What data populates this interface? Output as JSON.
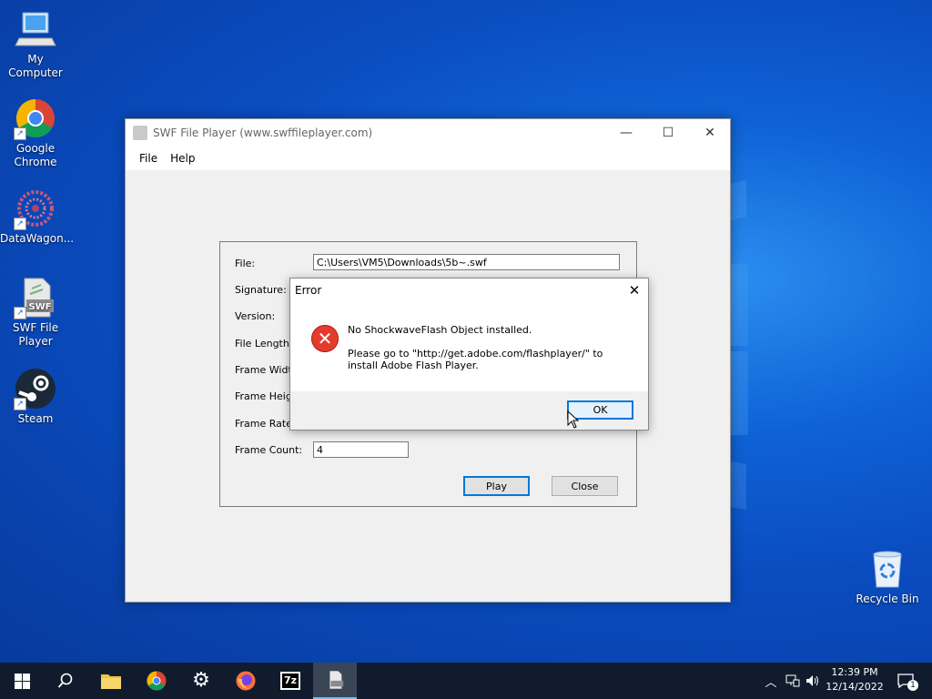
{
  "desktop": {
    "icons": [
      {
        "label": "My Computer"
      },
      {
        "label": "Google Chrome"
      },
      {
        "label": "DataWagon..."
      },
      {
        "label": "SWF File Player"
      },
      {
        "label": "Steam"
      },
      {
        "label": "Recycle Bin"
      }
    ]
  },
  "main_window": {
    "title": "SWF File Player (www.swffileplayer.com)",
    "menu": [
      "File",
      "Help"
    ],
    "fields": {
      "file_label": "File:",
      "file_value": "C:\\Users\\VM5\\Downloads\\5b~.swf",
      "signature_label": "Signature:",
      "version_label": "Version:",
      "file_length_label": "File Length:",
      "frame_width_label": "Frame Width:",
      "frame_height_label": "Frame Height:",
      "frame_rate_label": "Frame Rate:",
      "frame_count_label": "Frame Count:",
      "frame_count_value": "4"
    },
    "play_label": "Play",
    "close_label": "Close"
  },
  "error_dialog": {
    "title": "Error",
    "line1": "No ShockwaveFlash Object installed.",
    "line2": "Please go to \"http://get.adobe.com/flashplayer/\" to install Adobe Flash Player.",
    "ok_label": "OK"
  },
  "taskbar": {
    "time": "12:39 PM",
    "date": "12/14/2022",
    "notification_count": "1",
    "pinned": [
      "start-icon",
      "search-icon",
      "file-explorer-icon",
      "chrome-icon",
      "settings-icon",
      "firefox-icon",
      "7zip-icon",
      "swf-player-icon"
    ],
    "sevenzip_text": "7z",
    "swf_text": "SWF"
  },
  "colors": {
    "desktop_bg": "#0a4cc0",
    "taskbar_bg": "#101c2e",
    "error_red": "#e53b2f",
    "default_button_border": "#0078d7"
  }
}
